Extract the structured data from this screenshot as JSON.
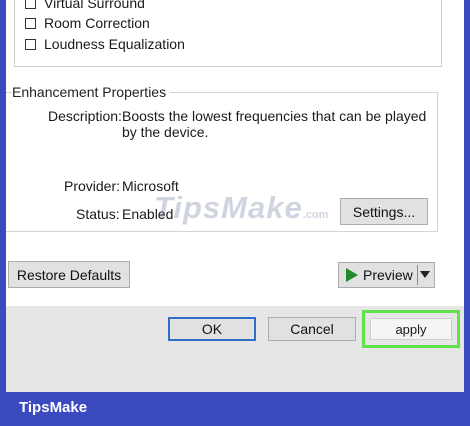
{
  "options": [
    {
      "label": "Virtual Surround",
      "checked": false
    },
    {
      "label": "Room Correction",
      "checked": false
    },
    {
      "label": "Loudness Equalization",
      "checked": false
    }
  ],
  "enhancement": {
    "title": "Enhancement Properties",
    "description_label": "Description:",
    "description_line1": "Boosts the lowest frequencies that can be played",
    "description_line2": "by the device.",
    "provider_label": "Provider:",
    "provider_value": "Microsoft",
    "status_label": "Status:",
    "status_value": "Enabled",
    "settings_label": "Settings..."
  },
  "actions": {
    "restore_defaults": "Restore Defaults",
    "preview": "Preview"
  },
  "footer": {
    "ok": "OK",
    "cancel": "Cancel",
    "apply": "apply"
  },
  "watermark": {
    "text": "TipsMake",
    "tld": ".com"
  },
  "brand": "TipsMake",
  "colors": {
    "frame": "#3b4bbf",
    "highlight": "#5fe24a",
    "play_icon": "#1f8a2a",
    "default_button_border": "#2f6fc9"
  }
}
